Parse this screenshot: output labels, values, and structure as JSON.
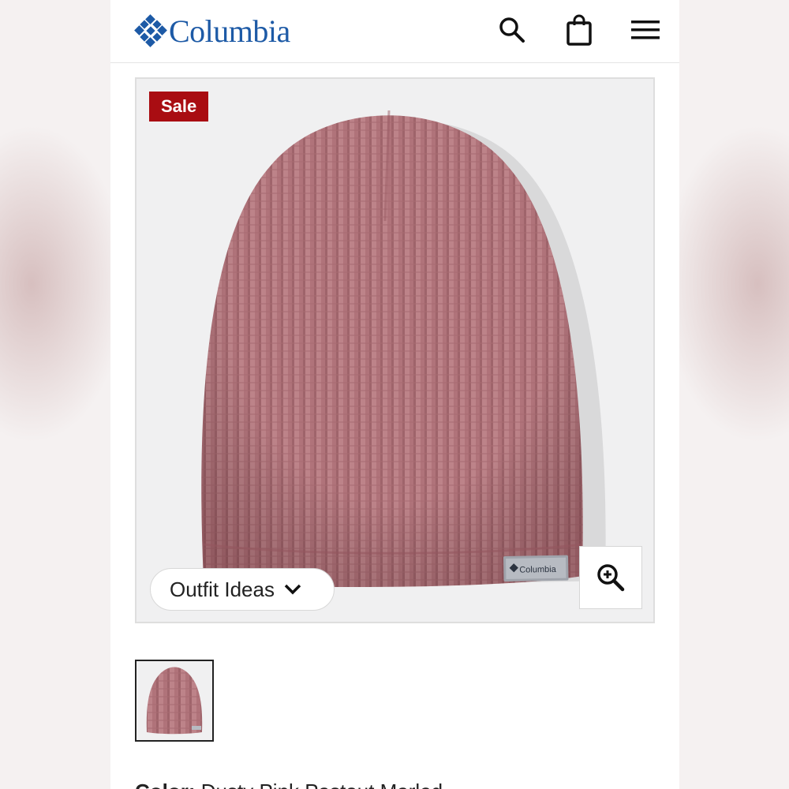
{
  "header": {
    "brand": "Columbia",
    "icons": [
      "search-icon",
      "shopping-bag-icon",
      "menu-icon"
    ]
  },
  "product": {
    "badge": "Sale",
    "outfit_ideas_label": "Outfit Ideas",
    "color_label": "Color:",
    "color_value": "Dusty Pink Pastout Marled"
  },
  "colors": {
    "brand_blue": "#1d5aa6",
    "sale_red": "#a90d12",
    "beanie_pink": "#b2747a"
  }
}
